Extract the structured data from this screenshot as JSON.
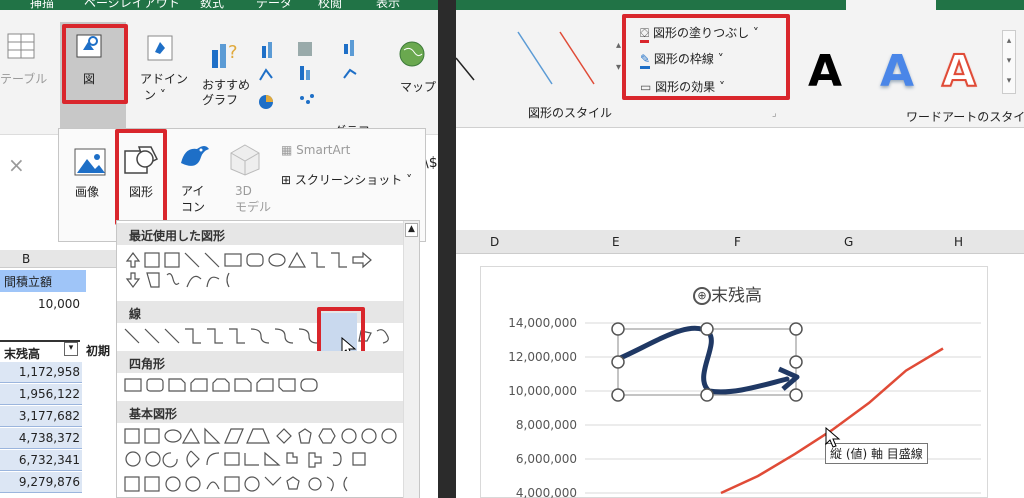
{
  "left": {
    "ribbon_tabs": [
      "挿描",
      "ページレイアウト",
      "数式",
      "データ",
      "校閲",
      "表示"
    ],
    "ribbon": {
      "table": "テーブル",
      "figure": "図",
      "addin": "アドイン",
      "recommended_charts": "おすすめ\nグラフ",
      "map": "マップ",
      "group_chart": "グラフ"
    },
    "formula_x": "×",
    "formula_dollar": "\\$",
    "insert_menu": {
      "image": "画像",
      "shapes": "図形",
      "icons": "アイ\nコン",
      "model3d": "3D\nモデル",
      "smartart": "SmartArt",
      "screenshot": "スクリーンショット"
    },
    "shapes_dropdown": {
      "recent": "最近使用した図形",
      "lines": "線",
      "rectangles": "四角形",
      "basic": "基本図形"
    },
    "sheet": {
      "col_b": "B",
      "header1": "間積立額",
      "value1": "10,000",
      "table_header": "末残高",
      "table_header2": "初期",
      "values": [
        "1,172,958",
        "1,956,122",
        "3,177,682",
        "4,738,372",
        "6,732,341",
        "9,279,876"
      ]
    }
  },
  "right": {
    "ribbon": {
      "fill": "図形の塗りつぶし",
      "outline": "図形の枠線",
      "effects": "図形の効果",
      "group_shape_style": "図形のスタイル",
      "group_wordart": "ワードアートのスタイル",
      "wordart_letter": "A"
    },
    "columns": [
      "D",
      "E",
      "F",
      "G",
      "H"
    ]
  },
  "chart_data": {
    "type": "line",
    "title": "末残高",
    "yticks": [
      "14,000,000",
      "12,000,000",
      "10,000,000",
      "8,000,000",
      "6,000,000",
      "4,000,000"
    ],
    "series": [
      {
        "color": "#e04b37",
        "values": [
          4000000,
          5000000,
          6300000,
          7700000,
          9300000,
          11200000,
          12500000
        ]
      }
    ],
    "tooltip": "縦 (値) 軸 目盛線"
  },
  "colors": {
    "excel_green": "#217346",
    "highlight_red": "#d9262c",
    "series_red": "#e04b37",
    "arrow_navy": "#1f3864"
  }
}
